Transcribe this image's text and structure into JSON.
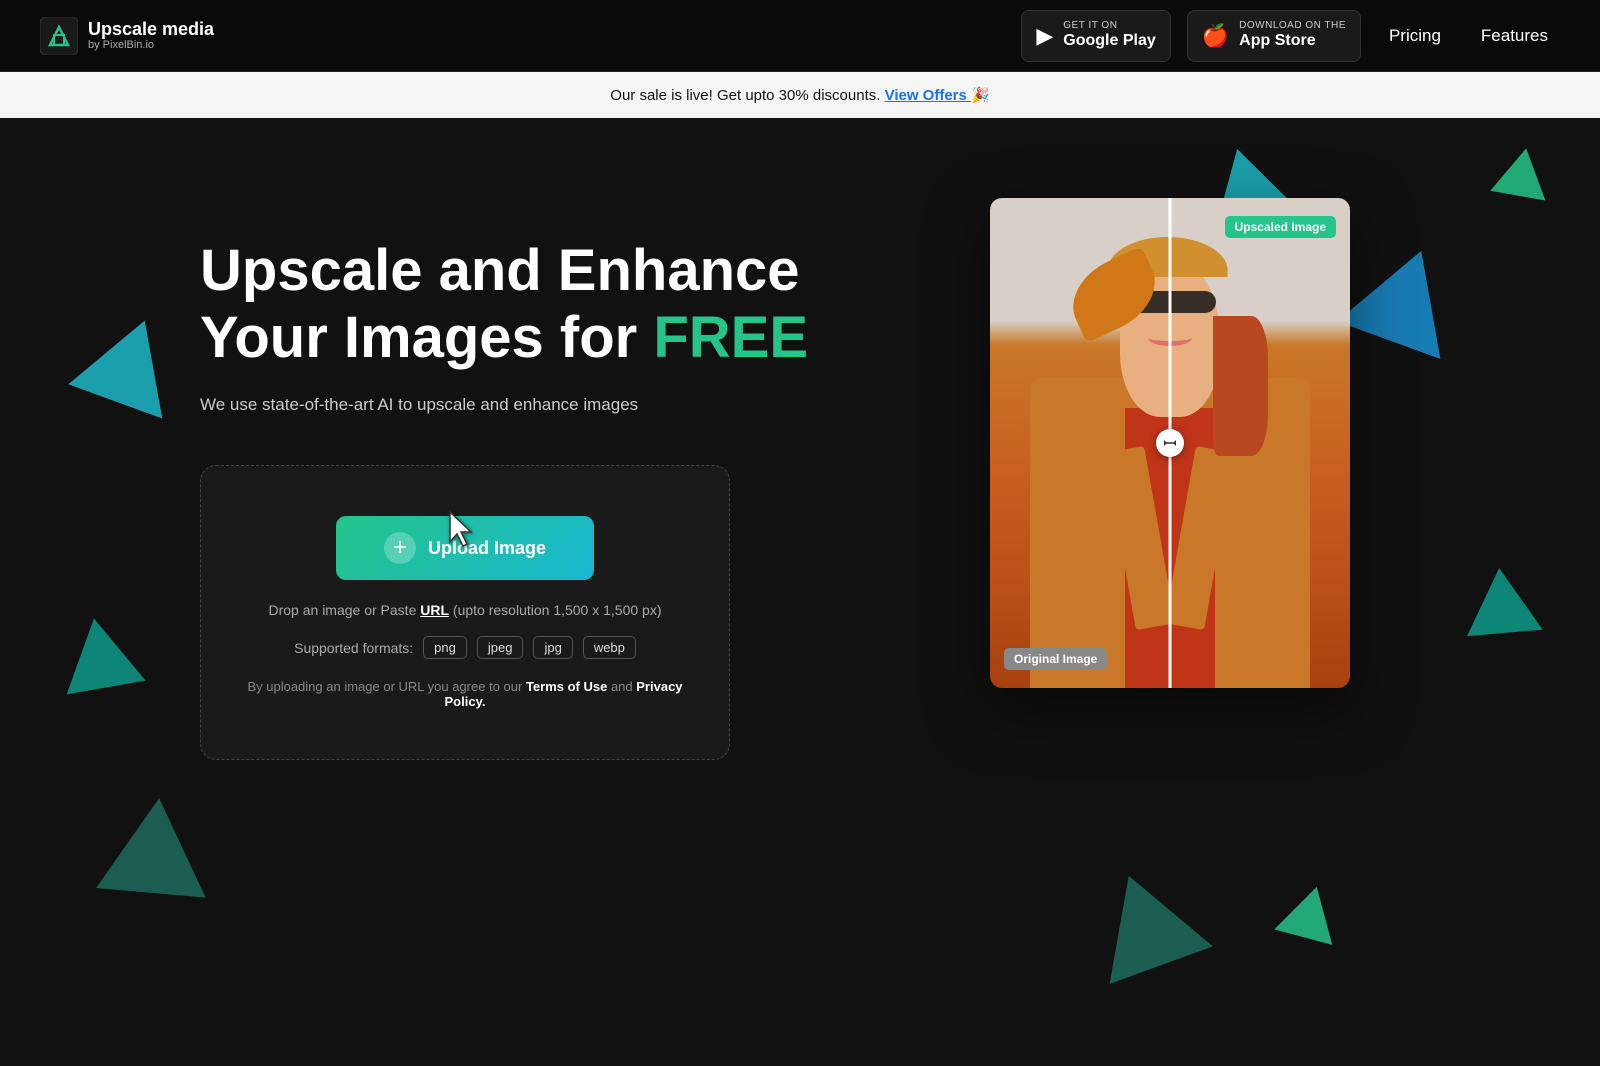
{
  "navbar": {
    "logo_title": "Upscale media",
    "logo_sub": "by PixelBin.io",
    "google_play_small": "GET IT ON",
    "google_play_name": "Google Play",
    "app_store_small": "Download on the",
    "app_store_name": "App Store",
    "nav_pricing": "Pricing",
    "nav_features": "Features"
  },
  "announcement": {
    "text": "Our sale is live! Get upto 30% discounts.",
    "link_text": "View Offers",
    "emoji": "🎉"
  },
  "hero": {
    "title_line1": "Upscale and Enhance",
    "title_line2_prefix": "Your Images for ",
    "title_free": "FREE",
    "subtitle": "We use state-of-the-art AI to upscale and enhance images",
    "upload_button": "Upload Image",
    "drop_hint_prefix": "Drop an image or Paste ",
    "drop_hint_url": "URL",
    "drop_hint_suffix": " (upto resolution 1,500 x 1,500 px)",
    "formats_label": "Supported formats:",
    "formats": [
      "png",
      "jpeg",
      "jpg",
      "webp"
    ],
    "terms_prefix": "By uploading an image or URL you agree to our ",
    "terms_link": "Terms of Use",
    "terms_and": " and ",
    "privacy_link": "Privacy Policy."
  },
  "compare": {
    "label_upscaled": "Upscaled Image",
    "label_original": "Original Image"
  },
  "colors": {
    "accent_green": "#24c48a",
    "accent_blue": "#1ab8d0",
    "bg_dark": "#111111"
  }
}
